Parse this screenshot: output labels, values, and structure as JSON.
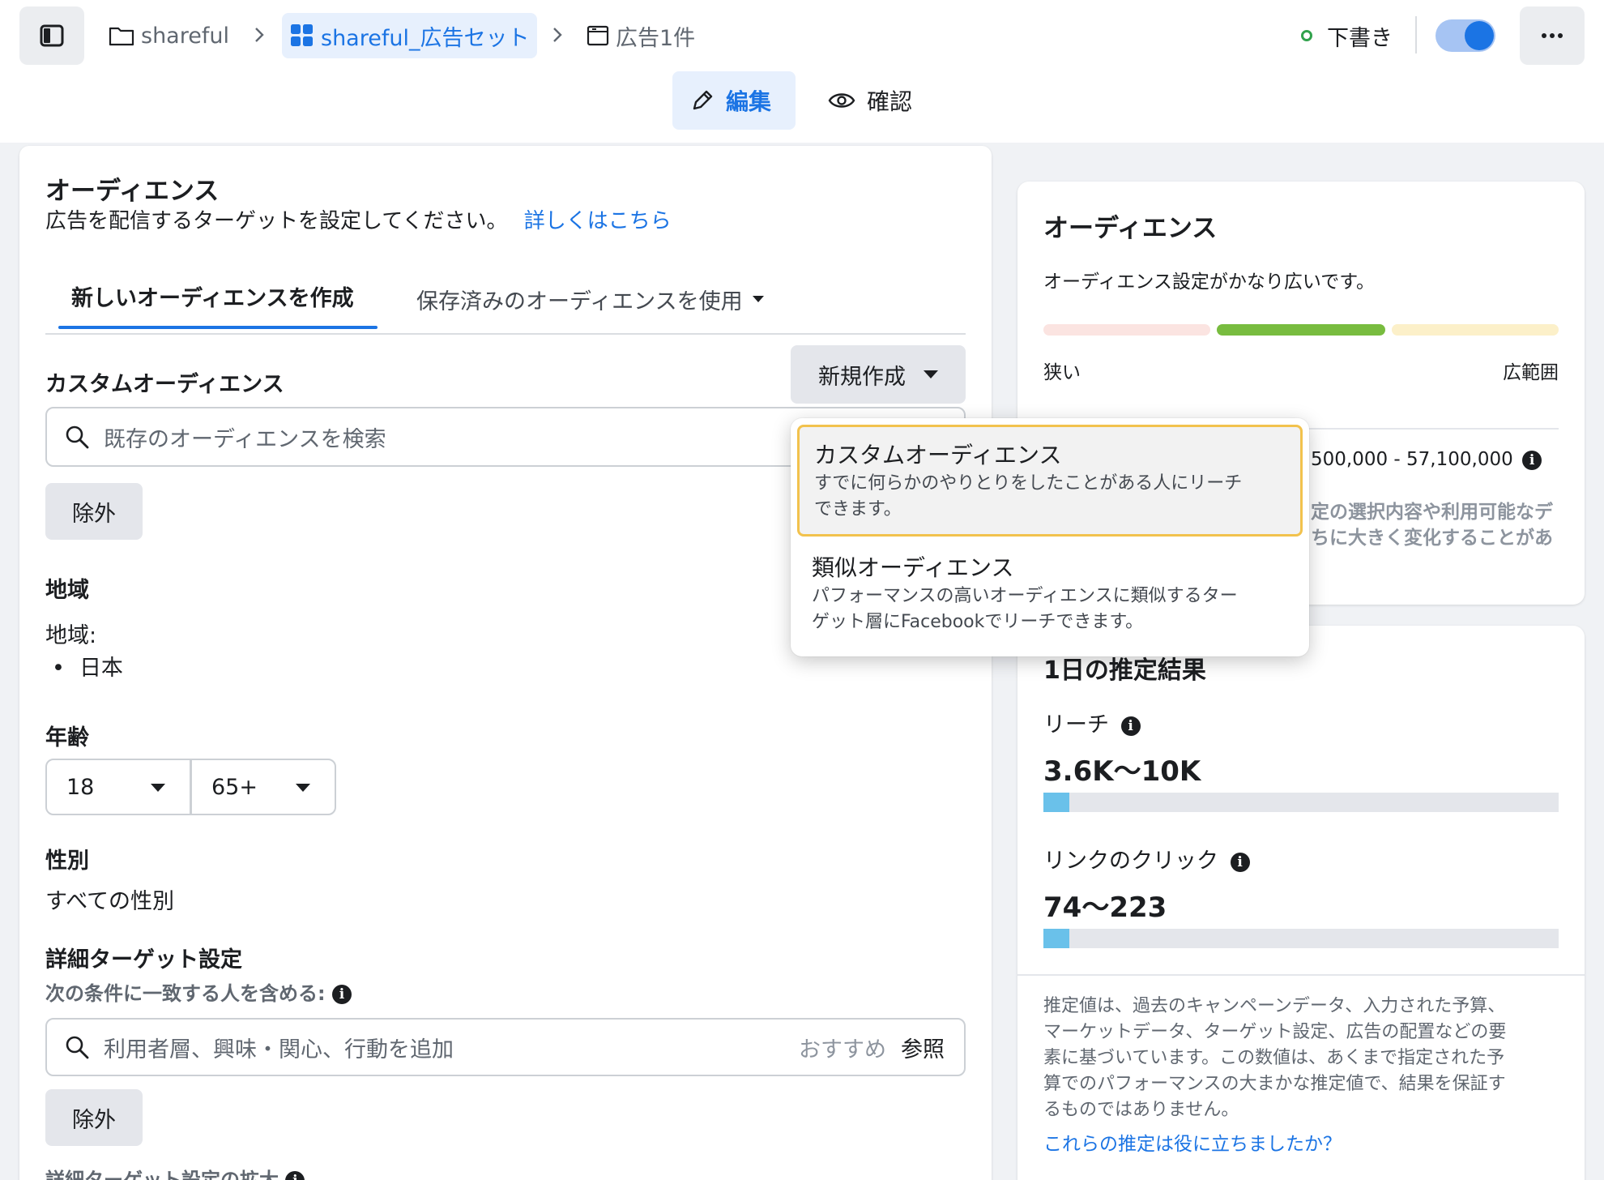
{
  "breadcrumb": {
    "campaign": "shareful",
    "adset": "shareful_広告セット",
    "ad": "広告1件"
  },
  "header": {
    "status": "下書き",
    "mode_edit": "編集",
    "mode_review": "確認"
  },
  "audience": {
    "title": "オーディエンス",
    "subtitle": "広告を配信するターゲットを設定してください。",
    "learn_more": "詳しくはこちら",
    "tabs": {
      "new": "新しいオーディエンスを作成",
      "saved": "保存済みのオーディエンスを使用"
    },
    "custom_label": "カスタムオーディエンス",
    "new_button": "新規作成",
    "search_placeholder": "既存のオーディエンスを検索",
    "exclude": "除外",
    "location_label": "地域",
    "location_sub": "地域:",
    "location_value": "日本",
    "age_label": "年齢",
    "age_min": "18",
    "age_max": "65+",
    "gender_label": "性別",
    "gender_value": "すべての性別",
    "detailed_label": "詳細ターゲット設定",
    "detailed_sub": "次の条件に一致する人を含める:",
    "detailed_placeholder": "利用者層、興味・関心、行動を追加",
    "suggest": "おすすめ",
    "browse": "参照",
    "exclude2": "除外",
    "expansion_label": "詳細ターゲット設定の拡大"
  },
  "dropdown": {
    "items": [
      {
        "title": "カスタムオーディエンス",
        "desc1": "すでに何らかのやりとりをしたことがある人にリーチ",
        "desc2": "できます。"
      },
      {
        "title": "類似オーディエンス",
        "desc1": "パフォーマンスの高いオーディエンスに類似するター",
        "desc2": "ゲット層にFacebookでリーチできます。"
      }
    ]
  },
  "definition": {
    "title": "オーディエンス",
    "desc": "オーディエンス設定がかなり広いです。",
    "narrow": "狭い",
    "broad": "広範囲",
    "size": "500,000 - 57,100,000",
    "note1": "定の選択内容や利用可能なデ",
    "note2": "ちに大きく変化することがあ",
    "meter_level": "broad",
    "colors": {
      "narrow": "#fbe4e1",
      "active": "#78bc3f",
      "broad": "#fcf0c9"
    }
  },
  "estimates": {
    "title": "1日の推定結果",
    "reach_label": "リーチ",
    "reach_value": "3.6K〜10K",
    "reach_fill": 0.05,
    "clicks_label": "リンクのクリック",
    "clicks_value": "74〜223",
    "clicks_fill": 0.05,
    "note": [
      "推定値は、過去のキャンペーンデータ、入力された予算、",
      "マーケットデータ、ターゲット設定、広告の配置などの要",
      "素に基づいています。この数値は、あくまで指定された予",
      "算でのパフォーマンスの大まかな推定値で、結果を保証す",
      "るものではありません。"
    ],
    "feedback": "これらの推定は役に立ちましたか？"
  }
}
